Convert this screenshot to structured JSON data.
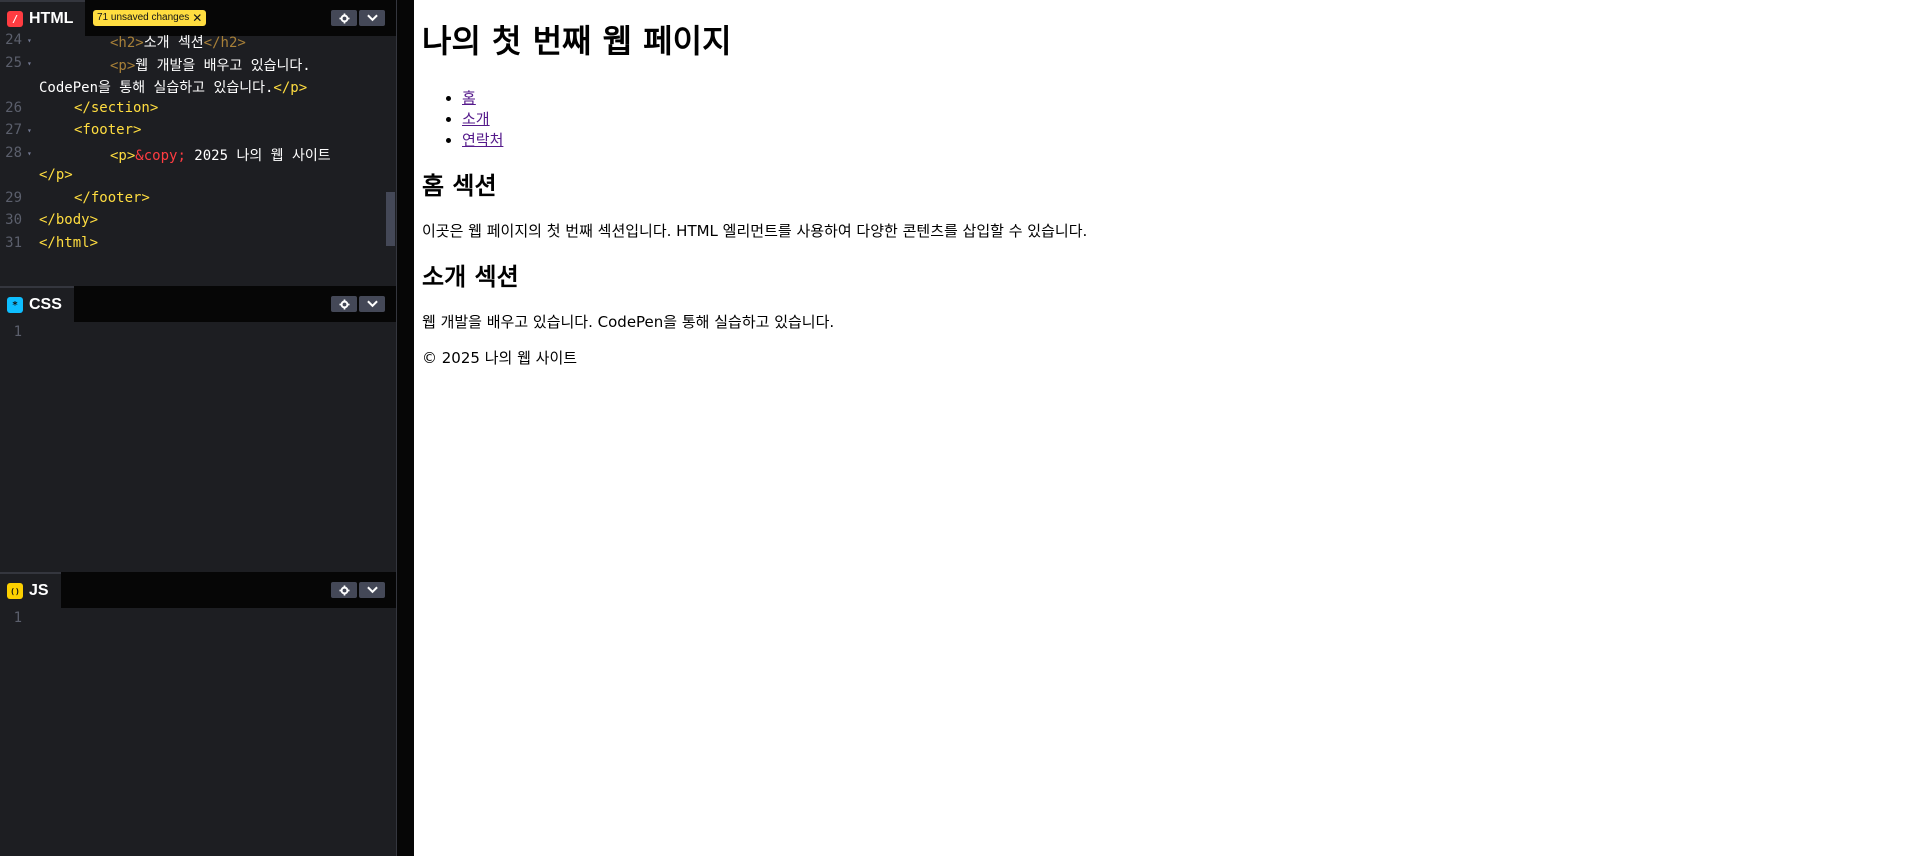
{
  "html_panel": {
    "title": "HTML",
    "icon": "/",
    "unsaved_label": "71 unsaved changes",
    "unsaved_close": "✕",
    "lines": [
      {
        "num": "24",
        "fold": "▾"
      },
      {
        "num": "25",
        "fold": "▾"
      },
      {
        "num": "",
        "fold": ""
      },
      {
        "num": "26",
        "fold": ""
      },
      {
        "num": "27",
        "fold": "▾"
      },
      {
        "num": "28",
        "fold": "▾"
      },
      {
        "num": "",
        "fold": ""
      },
      {
        "num": "29",
        "fold": ""
      },
      {
        "num": "30",
        "fold": ""
      },
      {
        "num": "31",
        "fold": ""
      }
    ],
    "code": {
      "l24_open": "<h2>",
      "l24_text": "소개 섹션",
      "l24_close": "</h2>",
      "l25_open": "<p>",
      "l25_text": "웹 개발을 배우고 있습니다.",
      "l25b_text": "CodePen을 통해 실습하고 있습니다.",
      "l25b_close": "</p>",
      "l26": "</section>",
      "l27": "<footer>",
      "l28_open": "<p>",
      "l28_entity": "&copy;",
      "l28_text": " 2025 나의 웹 사이트",
      "l28b_close": "</p>",
      "l29": "</footer>",
      "l30": "</body>",
      "l31": "</html>"
    }
  },
  "css_panel": {
    "title": "CSS",
    "icon": "*",
    "line1": "1"
  },
  "js_panel": {
    "title": "JS",
    "icon": "()",
    "line1": "1"
  },
  "icons": {
    "settings": "gear-icon",
    "collapse": "chevron-down-icon"
  },
  "colors": {
    "html_icon": "#ff3c41",
    "css_icon": "#0ebeff",
    "js_icon": "#fcd000",
    "tag": "#ffdd40",
    "entity": "#ff3c41"
  },
  "preview": {
    "h1": "나의 첫 번째 웹 페이지",
    "nav": [
      "홈",
      "소개",
      "연락처"
    ],
    "home_heading": "홈 섹션",
    "home_text": "이곳은 웹 페이지의 첫 번째 섹션입니다. HTML 엘리먼트를 사용하여 다양한 콘텐츠를 삽입할 수 있습니다.",
    "about_heading": "소개 섹션",
    "about_text": "웹 개발을 배우고 있습니다. CodePen을 통해 실습하고 있습니다.",
    "footer_text": "© 2025 나의 웹 사이트"
  }
}
